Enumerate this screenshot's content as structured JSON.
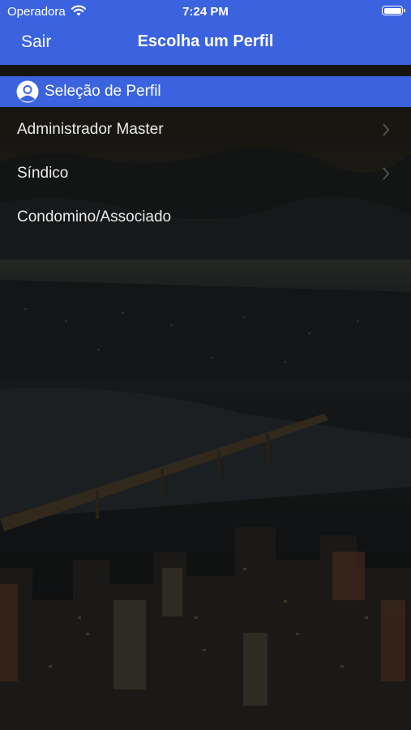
{
  "status_bar": {
    "carrier": "Operadora",
    "time": "7:24 PM"
  },
  "nav": {
    "back_label": "Sair",
    "title": "Escolha um Perfil"
  },
  "section": {
    "title": "Seleção de Perfil"
  },
  "profiles": [
    {
      "label": "Administrador Master"
    },
    {
      "label": "Síndico"
    },
    {
      "label": "Condomino/Associado"
    }
  ],
  "colors": {
    "accent": "#3b63e0",
    "text": "#ffffff"
  }
}
